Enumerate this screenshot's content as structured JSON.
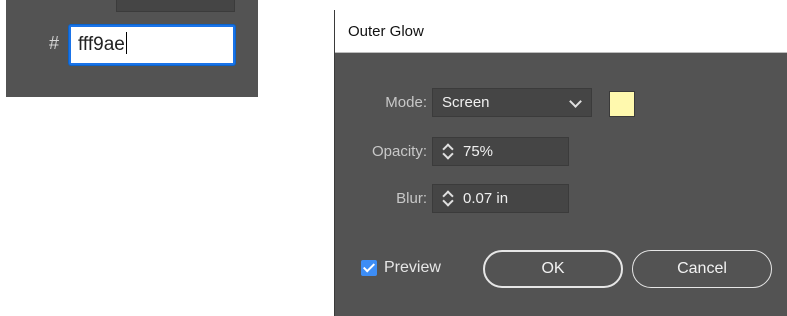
{
  "color_panel": {
    "hash": "#",
    "hex_value": "fff9ae"
  },
  "dialog": {
    "title": "Outer Glow",
    "mode": {
      "label": "Mode:",
      "value": "Screen",
      "swatch_color": "#fff9ae"
    },
    "opacity": {
      "label": "Opacity:",
      "value": "75%"
    },
    "blur": {
      "label": "Blur:",
      "value": "0.07 in"
    },
    "preview": {
      "label": "Preview",
      "checked": true
    },
    "buttons": {
      "ok": "OK",
      "cancel": "Cancel"
    }
  },
  "colors": {
    "panel_bg": "#535353",
    "field_bg": "#454545",
    "focus_border": "#1a73e8",
    "checkbox_accent": "#3d8df5"
  },
  "icons": [
    "chevron-down-icon",
    "spinner-icon",
    "checkmark-icon"
  ]
}
